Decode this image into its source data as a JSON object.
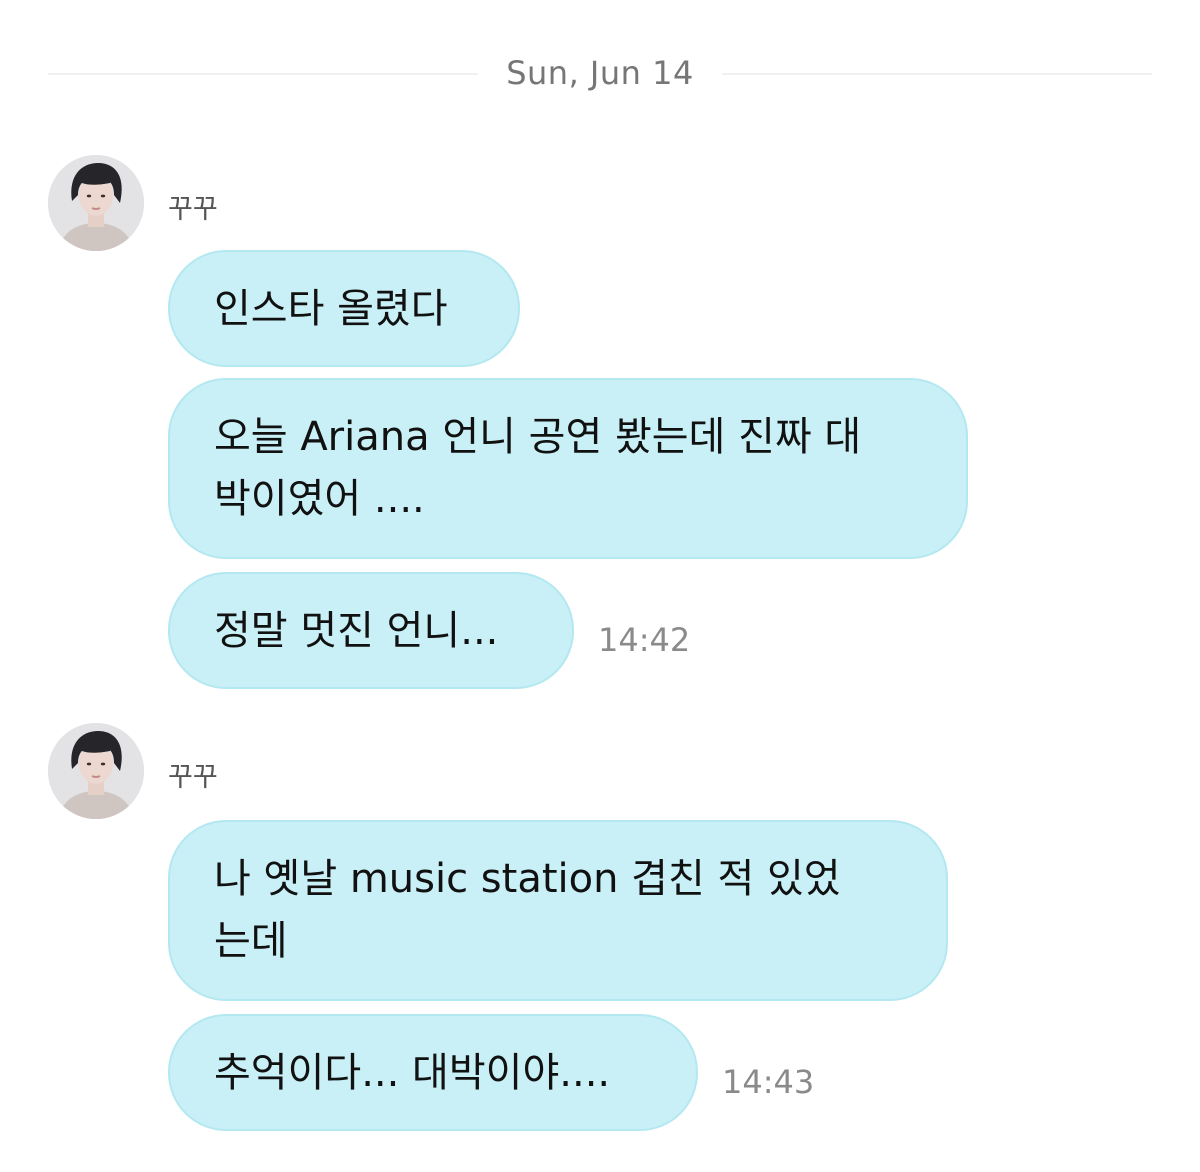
{
  "date_separator": "Sun, Jun 14",
  "groups": [
    {
      "sender": "꾸꾸",
      "avatar_icon": "profile-photo-icon",
      "messages": [
        "인스타 올렸다",
        "오늘 Ariana 언니 공연 봤는데 진짜 대\n박이였어 ....",
        "정말 멋진 언니..."
      ],
      "time": "14:42"
    },
    {
      "sender": "꾸꾸",
      "avatar_icon": "profile-photo-icon",
      "messages": [
        "나 옛날 music station 겹친 적 있었\n는데",
        "추억이다... 대박이야...."
      ],
      "time": "14:43"
    }
  ],
  "colors": {
    "bubble": "#c8f0f6",
    "bubble_border": "#b4e8f0",
    "time": "#8a8a8a",
    "date": "#767676"
  }
}
